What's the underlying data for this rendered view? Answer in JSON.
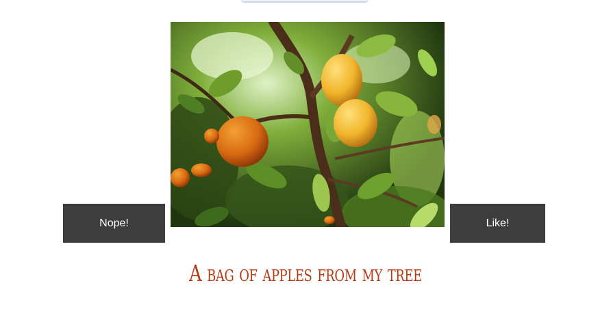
{
  "post": {
    "image_alt": "Apples on a tree branch among green leaves",
    "caption": "A bag of apples from my tree"
  },
  "actions": {
    "nope_label": "Nope!",
    "like_label": "Like!"
  },
  "colors": {
    "button_bg": "#3d3d3d",
    "button_text": "#ffffff",
    "caption": "#b83a14"
  }
}
